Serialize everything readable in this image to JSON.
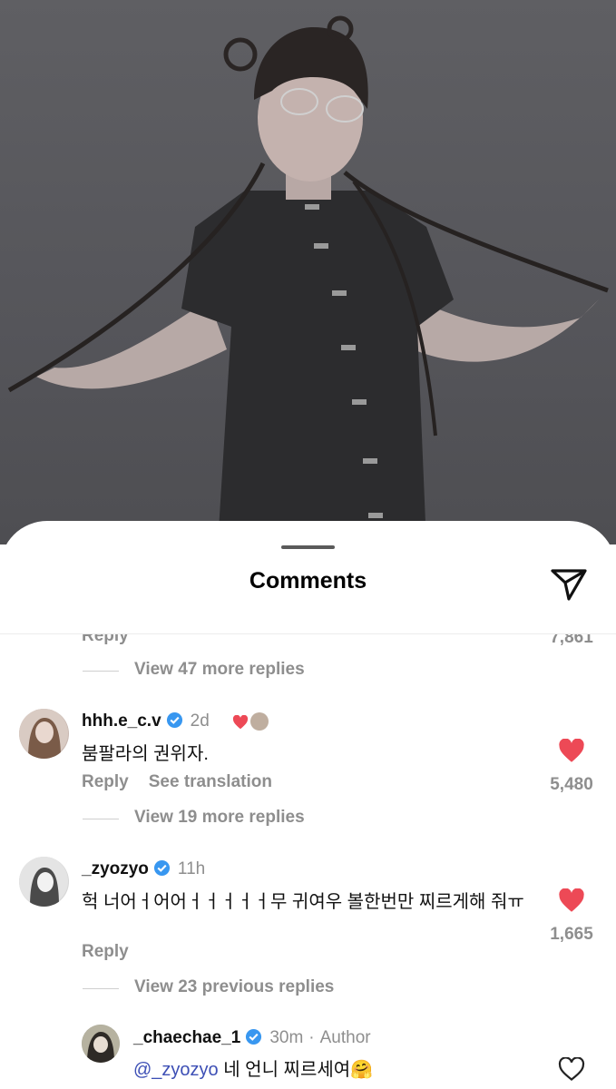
{
  "sheet": {
    "title": "Comments"
  },
  "top_partial": {
    "reply": "Reply",
    "count": "7,861"
  },
  "thread1_view": "View 47 more replies",
  "comments": [
    {
      "username": "hhh.e_c.v",
      "verified": true,
      "time": "2d",
      "text": "붐팔라의 권위자.",
      "actions": [
        "Reply",
        "See translation"
      ],
      "likes": "5,480",
      "liked": true
    },
    {
      "username": "_zyozyo",
      "verified": true,
      "time": "11h",
      "text": "헉 너어ㅓ어어ㅓㅓㅓㅓㅓ무 귀여우 볼한번만 찌르게해 줘ㅠ",
      "actions": [
        "Reply"
      ],
      "likes": "1,665",
      "liked": true
    }
  ],
  "view_more_2": "View 19 more replies",
  "view_prev_3": "View 23 previous replies",
  "reply": {
    "username": "_chaechae_1",
    "verified": true,
    "time": "30m",
    "author_tag": "Author",
    "mention": "@_zyozyo",
    "text": " 네 언니 찌르세여🤗"
  },
  "colors": {
    "like": "#ed4956",
    "verified": "#3897f0",
    "mention": "#3d4fb5"
  },
  "icons": [
    "share-icon",
    "heart-icon",
    "verified-badge-icon"
  ]
}
